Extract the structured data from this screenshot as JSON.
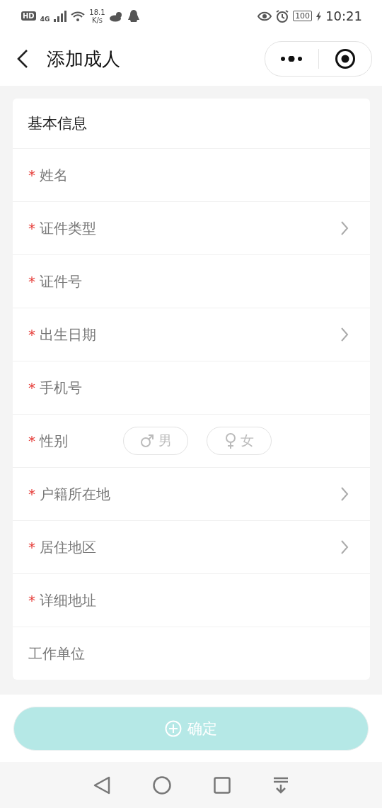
{
  "status_bar": {
    "hd": "HD",
    "network": "4G",
    "speed": "18.1",
    "speed_unit": "K/s",
    "battery": "100",
    "time": "10:21"
  },
  "header": {
    "title": "添加成人"
  },
  "section": {
    "title": "基本信息"
  },
  "fields": [
    {
      "kind": "input",
      "label": "姓名",
      "required": true
    },
    {
      "kind": "select",
      "label": "证件类型",
      "required": true
    },
    {
      "kind": "input",
      "label": "证件号",
      "required": true
    },
    {
      "kind": "select",
      "label": "出生日期",
      "required": true
    },
    {
      "kind": "input",
      "label": "手机号",
      "required": true
    },
    {
      "kind": "gender",
      "label": "性别",
      "required": true,
      "options": [
        {
          "label": "男",
          "kind": "male",
          "selected": false
        },
        {
          "label": "女",
          "kind": "female",
          "selected": false
        }
      ]
    },
    {
      "kind": "select",
      "label": "户籍所在地",
      "required": true
    },
    {
      "kind": "select",
      "label": "居住地区",
      "required": true
    },
    {
      "kind": "input",
      "label": "详细地址",
      "required": true
    },
    {
      "kind": "input",
      "label": "工作单位",
      "required": false
    }
  ],
  "required_mark": "*",
  "submit": {
    "label": "确定",
    "disabled": true
  }
}
